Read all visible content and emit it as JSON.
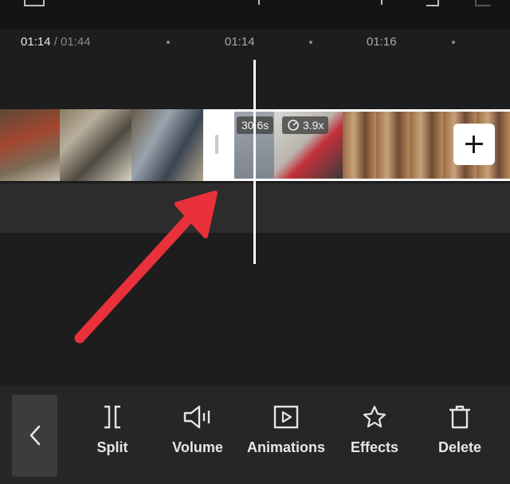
{
  "ruler": {
    "current_time": "01:14",
    "total_duration": " / 01:44",
    "tick_labels": [
      "01:14",
      "01:16"
    ]
  },
  "clip": {
    "duration_badge": "30.6s",
    "speed_badge": "3.9x"
  },
  "toolbar": {
    "split_label": "Split",
    "volume_label": "Volume",
    "animations_label": "Animations",
    "effects_label": "Effects",
    "delete_label": "Delete"
  },
  "colors": {
    "background": "#1d1d1d",
    "toolbar_bg": "#262626",
    "arrow": "#e8313a",
    "playhead": "#ffffff"
  },
  "icons": [
    "chevron-left-icon",
    "split-icon",
    "volume-icon",
    "animations-icon",
    "effects-icon",
    "delete-icon",
    "plus-icon",
    "speed-icon"
  ]
}
